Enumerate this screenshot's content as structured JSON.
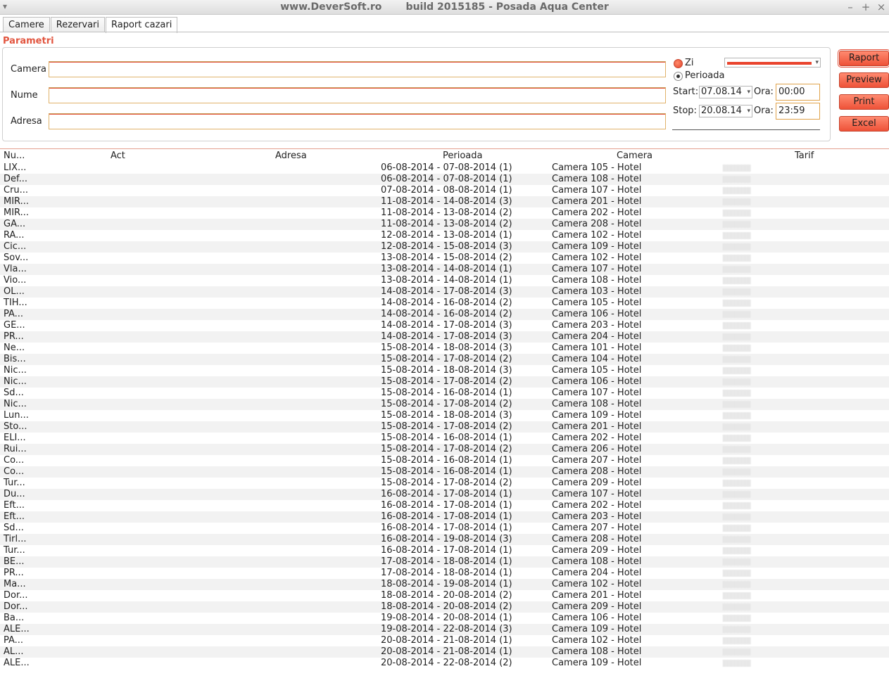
{
  "window": {
    "title": "www.DeverSoft.ro       build 2015185 - Posada Aqua Center",
    "menu_icon": "chevron-down-icon",
    "minimize": "–",
    "maximize": "+",
    "close": "×"
  },
  "tabs": [
    {
      "label": "Camere",
      "active": false
    },
    {
      "label": "Rezervari",
      "active": false
    },
    {
      "label": "Raport cazari",
      "active": true
    }
  ],
  "params": {
    "title": "Parametri",
    "camera_label": "Camera",
    "camera_value": "",
    "nume_label": "Nume",
    "nume_value": "",
    "adresa_label": "Adresa",
    "adresa_value": "",
    "zi_label": "Zi",
    "perioada_label": "Perioada",
    "start_label": "Start:",
    "start_date": "07.08.14",
    "start_ora_label": "Ora:",
    "start_time": "00:00",
    "stop_label": "Stop:",
    "stop_date": "20.08.14",
    "stop_ora_label": "Ora:",
    "stop_time": "23:59"
  },
  "buttons": {
    "raport": "Raport",
    "preview": "Preview",
    "print": "Print",
    "excel": "Excel"
  },
  "table": {
    "columns": [
      "Nu...",
      "Act",
      "Adresa",
      "Perioada",
      "Camera",
      "Tarif"
    ],
    "rows": [
      {
        "name": "LIX...",
        "period": "06-08-2014 - 07-08-2014 (1)",
        "camera": "Camera 105 - Hotel"
      },
      {
        "name": "Def...",
        "period": "06-08-2014 - 07-08-2014 (1)",
        "camera": "Camera 108 - Hotel"
      },
      {
        "name": "Cru...",
        "period": "07-08-2014 - 08-08-2014 (1)",
        "camera": "Camera 107 - Hotel"
      },
      {
        "name": "MIR...",
        "period": "11-08-2014 - 14-08-2014 (3)",
        "camera": "Camera 201 - Hotel"
      },
      {
        "name": "MIR...",
        "period": "11-08-2014 - 13-08-2014 (2)",
        "camera": "Camera 202 - Hotel"
      },
      {
        "name": "GA...",
        "period": "11-08-2014 - 13-08-2014 (2)",
        "camera": "Camera 208 - Hotel"
      },
      {
        "name": "RA...",
        "period": "12-08-2014 - 13-08-2014 (1)",
        "camera": "Camera 102 - Hotel"
      },
      {
        "name": "Cic...",
        "period": "12-08-2014 - 15-08-2014 (3)",
        "camera": "Camera 109 - Hotel"
      },
      {
        "name": "Sov...",
        "period": "13-08-2014 - 15-08-2014 (2)",
        "camera": "Camera 102 - Hotel"
      },
      {
        "name": "Vla...",
        "period": "13-08-2014 - 14-08-2014 (1)",
        "camera": "Camera 107 - Hotel"
      },
      {
        "name": "Vio...",
        "period": "13-08-2014 - 14-08-2014 (1)",
        "camera": "Camera 108 - Hotel"
      },
      {
        "name": "OL...",
        "period": "14-08-2014 - 17-08-2014 (3)",
        "camera": "Camera 103 - Hotel"
      },
      {
        "name": "TIH...",
        "period": "14-08-2014 - 16-08-2014 (2)",
        "camera": "Camera 105 - Hotel"
      },
      {
        "name": "PA...",
        "period": "14-08-2014 - 16-08-2014 (2)",
        "camera": "Camera 106 - Hotel"
      },
      {
        "name": "GE...",
        "period": "14-08-2014 - 17-08-2014 (3)",
        "camera": "Camera 203 - Hotel"
      },
      {
        "name": "PR...",
        "period": "14-08-2014 - 17-08-2014 (3)",
        "camera": "Camera 204 - Hotel"
      },
      {
        "name": "Ne...",
        "period": "15-08-2014 - 18-08-2014 (3)",
        "camera": "Camera 101 - Hotel"
      },
      {
        "name": "Bis...",
        "period": "15-08-2014 - 17-08-2014 (2)",
        "camera": "Camera 104 - Hotel"
      },
      {
        "name": "Nic...",
        "period": "15-08-2014 - 18-08-2014 (3)",
        "camera": "Camera 105 - Hotel"
      },
      {
        "name": "Nic...",
        "period": "15-08-2014 - 17-08-2014 (2)",
        "camera": "Camera 106 - Hotel"
      },
      {
        "name": "Sd...",
        "period": "15-08-2014 - 16-08-2014 (1)",
        "camera": "Camera 107 - Hotel"
      },
      {
        "name": "Nic...",
        "period": "15-08-2014 - 17-08-2014 (2)",
        "camera": "Camera 108 - Hotel"
      },
      {
        "name": "Lun...",
        "period": "15-08-2014 - 18-08-2014 (3)",
        "camera": "Camera 109 - Hotel"
      },
      {
        "name": "Sto...",
        "period": "15-08-2014 - 17-08-2014 (2)",
        "camera": "Camera 201 - Hotel"
      },
      {
        "name": "ELI...",
        "period": "15-08-2014 - 16-08-2014 (1)",
        "camera": "Camera 202 - Hotel"
      },
      {
        "name": "Rui...",
        "period": "15-08-2014 - 17-08-2014 (2)",
        "camera": "Camera 206 - Hotel"
      },
      {
        "name": "Co...",
        "period": "15-08-2014 - 16-08-2014 (1)",
        "camera": "Camera 207 - Hotel"
      },
      {
        "name": "Co...",
        "period": "15-08-2014 - 16-08-2014 (1)",
        "camera": "Camera 208 - Hotel"
      },
      {
        "name": "Tur...",
        "period": "15-08-2014 - 17-08-2014 (2)",
        "camera": "Camera 209 - Hotel"
      },
      {
        "name": "Du...",
        "period": "16-08-2014 - 17-08-2014 (1)",
        "camera": "Camera 107 - Hotel"
      },
      {
        "name": "Eft...",
        "period": "16-08-2014 - 17-08-2014 (1)",
        "camera": "Camera 202 - Hotel"
      },
      {
        "name": "Eft...",
        "period": "16-08-2014 - 17-08-2014 (1)",
        "camera": "Camera 203 - Hotel"
      },
      {
        "name": "Sd...",
        "period": "16-08-2014 - 17-08-2014 (1)",
        "camera": "Camera 207 - Hotel"
      },
      {
        "name": "Tirl...",
        "period": "16-08-2014 - 19-08-2014 (3)",
        "camera": "Camera 208 - Hotel"
      },
      {
        "name": "Tur...",
        "period": "16-08-2014 - 17-08-2014 (1)",
        "camera": "Camera 209 - Hotel"
      },
      {
        "name": "BE...",
        "period": "17-08-2014 - 18-08-2014 (1)",
        "camera": "Camera 108 - Hotel"
      },
      {
        "name": "PR...",
        "period": "17-08-2014 - 18-08-2014 (1)",
        "camera": "Camera 204 - Hotel"
      },
      {
        "name": "Ma...",
        "period": "18-08-2014 - 19-08-2014 (1)",
        "camera": "Camera 102 - Hotel"
      },
      {
        "name": "Dor...",
        "period": "18-08-2014 - 20-08-2014 (2)",
        "camera": "Camera 201 - Hotel"
      },
      {
        "name": "Dor...",
        "period": "18-08-2014 - 20-08-2014 (2)",
        "camera": "Camera 209 - Hotel"
      },
      {
        "name": "Ba...",
        "period": "19-08-2014 - 20-08-2014 (1)",
        "camera": "Camera 106 - Hotel"
      },
      {
        "name": "ALE...",
        "period": "19-08-2014 - 22-08-2014 (3)",
        "camera": "Camera 109 - Hotel"
      },
      {
        "name": "PA...",
        "period": "20-08-2014 - 21-08-2014 (1)",
        "camera": "Camera 102 - Hotel"
      },
      {
        "name": "AL...",
        "period": "20-08-2014 - 21-08-2014 (1)",
        "camera": "Camera 108 - Hotel"
      },
      {
        "name": "ALE...",
        "period": "20-08-2014 - 22-08-2014 (2)",
        "camera": "Camera 109 - Hotel"
      }
    ]
  },
  "colors": {
    "accent": "#e2553f",
    "button": "#ee5238",
    "field_border": "#e0b26a"
  }
}
